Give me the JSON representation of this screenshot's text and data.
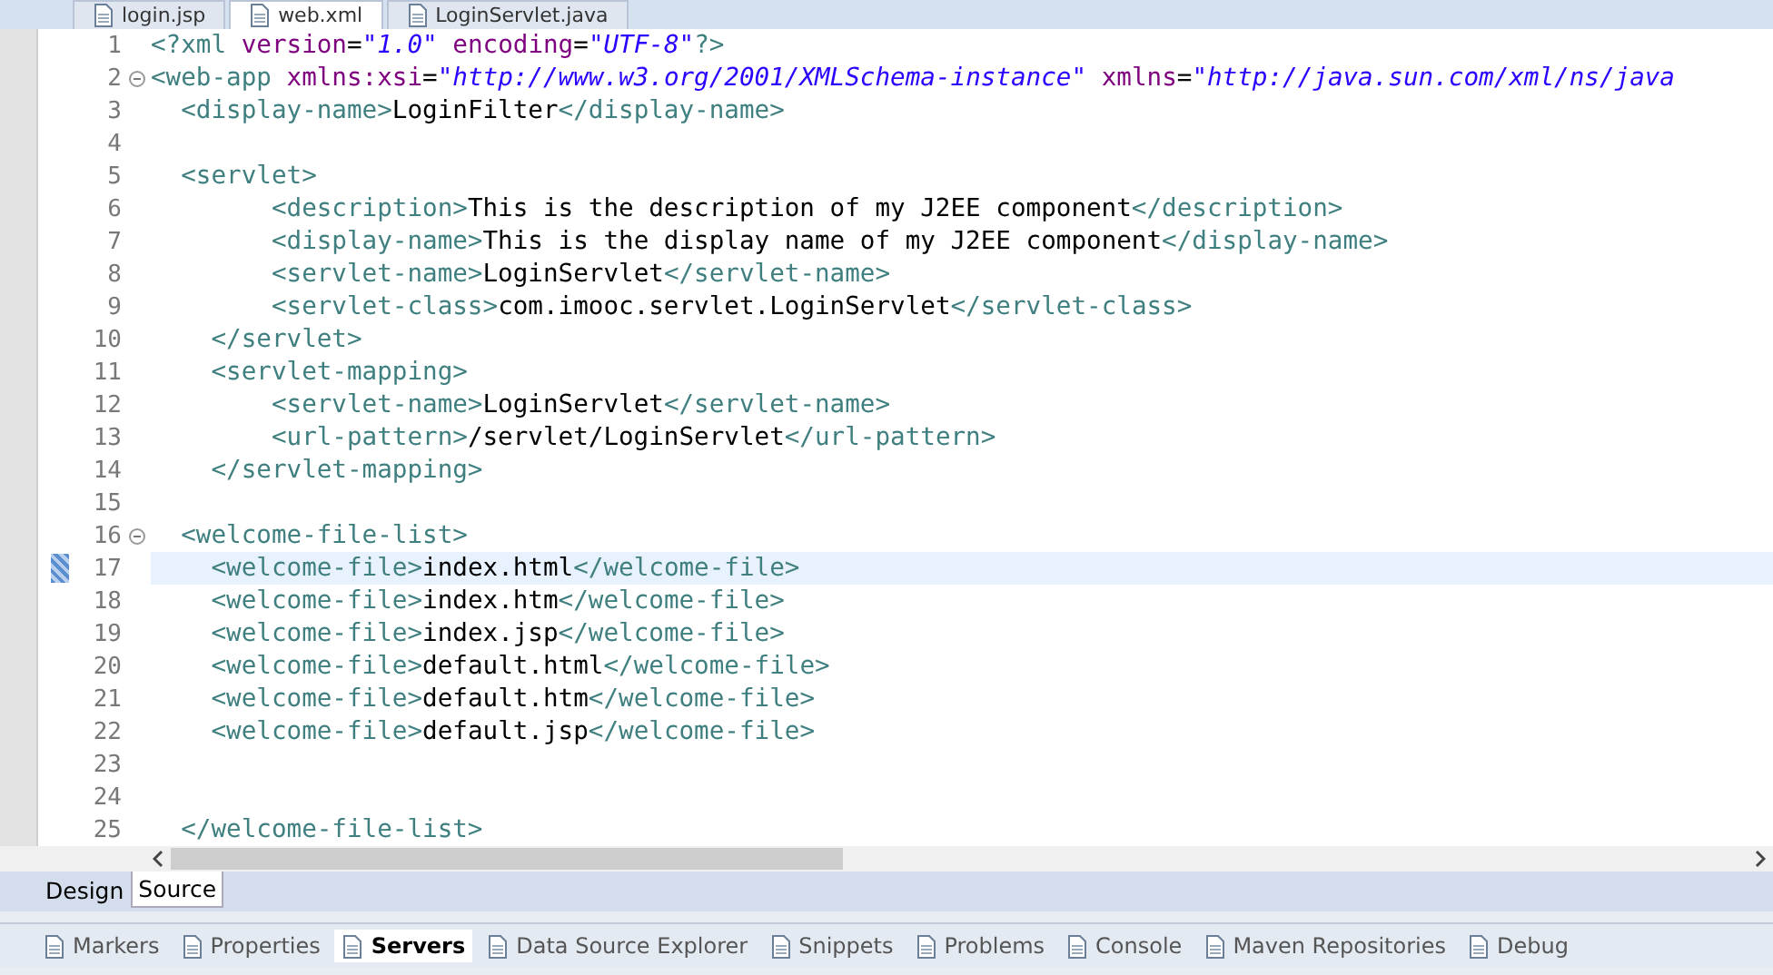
{
  "editor_tabs": [
    {
      "label": "login.jsp",
      "selected": false
    },
    {
      "label": "web.xml",
      "selected": true
    },
    {
      "label": "LoginServlet.java",
      "selected": false
    }
  ],
  "code_lines": [
    {
      "number": "1",
      "fold": false,
      "selected": false,
      "tokens": [
        {
          "kind": "tag",
          "text": "<?xml "
        },
        {
          "kind": "attr",
          "text": "version"
        },
        {
          "kind": "text",
          "text": "="
        },
        {
          "kind": "string",
          "text": "\"1.0\""
        },
        {
          "kind": "attr",
          "text": " encoding"
        },
        {
          "kind": "text",
          "text": "="
        },
        {
          "kind": "string",
          "text": "\"UTF-8\""
        },
        {
          "kind": "tag",
          "text": "?>"
        }
      ]
    },
    {
      "number": "2",
      "fold": true,
      "selected": false,
      "tokens": [
        {
          "kind": "tag",
          "text": "<web-app "
        },
        {
          "kind": "attr",
          "text": "xmlns:xsi"
        },
        {
          "kind": "text",
          "text": "="
        },
        {
          "kind": "string",
          "text": "\"http://www.w3.org/2001/XMLSchema-instance\""
        },
        {
          "kind": "attr",
          "text": " xmlns"
        },
        {
          "kind": "text",
          "text": "="
        },
        {
          "kind": "string",
          "text": "\"http://java.sun.com/xml/ns/java"
        }
      ]
    },
    {
      "number": "3",
      "fold": false,
      "selected": false,
      "tokens": [
        {
          "kind": "tag",
          "text": "  <display-name>"
        },
        {
          "kind": "text",
          "text": "LoginFilter"
        },
        {
          "kind": "tag",
          "text": "</display-name>"
        }
      ]
    },
    {
      "number": "4",
      "fold": false,
      "selected": false
    },
    {
      "number": "5",
      "fold": false,
      "selected": false,
      "tokens": [
        {
          "kind": "tag",
          "text": "  <servlet>"
        }
      ]
    },
    {
      "number": "6",
      "fold": false,
      "selected": false,
      "tokens": [
        {
          "kind": "tag",
          "text": "        <description>"
        },
        {
          "kind": "text",
          "text": "This is the description of my J2EE component"
        },
        {
          "kind": "tag",
          "text": "</description>"
        }
      ]
    },
    {
      "number": "7",
      "fold": false,
      "selected": false,
      "tokens": [
        {
          "kind": "tag",
          "text": "        <display-name>"
        },
        {
          "kind": "text",
          "text": "This is the display name of my J2EE component"
        },
        {
          "kind": "tag",
          "text": "</display-name>"
        }
      ]
    },
    {
      "number": "8",
      "fold": false,
      "selected": false,
      "tokens": [
        {
          "kind": "tag",
          "text": "        <servlet-name>"
        },
        {
          "kind": "text",
          "text": "LoginServlet"
        },
        {
          "kind": "tag",
          "text": "</servlet-name>"
        }
      ]
    },
    {
      "number": "9",
      "fold": false,
      "selected": false,
      "tokens": [
        {
          "kind": "tag",
          "text": "        <servlet-class>"
        },
        {
          "kind": "text",
          "text": "com.imooc.servlet.LoginServlet"
        },
        {
          "kind": "tag",
          "text": "</servlet-class>"
        }
      ]
    },
    {
      "number": "10",
      "fold": false,
      "selected": false,
      "tokens": [
        {
          "kind": "tag",
          "text": "    </servlet>"
        }
      ]
    },
    {
      "number": "11",
      "fold": false,
      "selected": false,
      "tokens": [
        {
          "kind": "tag",
          "text": "    <servlet-mapping>"
        }
      ]
    },
    {
      "number": "12",
      "fold": false,
      "selected": false,
      "tokens": [
        {
          "kind": "tag",
          "text": "        <servlet-name>"
        },
        {
          "kind": "text",
          "text": "LoginServlet"
        },
        {
          "kind": "tag",
          "text": "</servlet-name>"
        }
      ]
    },
    {
      "number": "13",
      "fold": false,
      "selected": false,
      "tokens": [
        {
          "kind": "tag",
          "text": "        <url-pattern>"
        },
        {
          "kind": "text",
          "text": "/servlet/LoginServlet"
        },
        {
          "kind": "tag",
          "text": "</url-pattern>"
        }
      ]
    },
    {
      "number": "14",
      "fold": false,
      "selected": false,
      "tokens": [
        {
          "kind": "tag",
          "text": "    </servlet-mapping>"
        }
      ]
    },
    {
      "number": "15",
      "fold": false,
      "selected": false
    },
    {
      "number": "16",
      "fold": true,
      "selected": false,
      "tokens": [
        {
          "kind": "tag",
          "text": "  <welcome-file-list>"
        }
      ]
    },
    {
      "number": "17",
      "fold": false,
      "selected": true,
      "tokens": [
        {
          "kind": "tag",
          "text": "    <welcome-file>"
        },
        {
          "kind": "text",
          "text": "index.html"
        },
        {
          "kind": "tag",
          "text": "</welcome-file>"
        }
      ]
    },
    {
      "number": "18",
      "fold": false,
      "selected": false,
      "tokens": [
        {
          "kind": "tag",
          "text": "    <welcome-file>"
        },
        {
          "kind": "text",
          "text": "index.htm"
        },
        {
          "kind": "tag",
          "text": "</welcome-file>"
        }
      ]
    },
    {
      "number": "19",
      "fold": false,
      "selected": false,
      "tokens": [
        {
          "kind": "tag",
          "text": "    <welcome-file>"
        },
        {
          "kind": "text",
          "text": "index.jsp"
        },
        {
          "kind": "tag",
          "text": "</welcome-file>"
        }
      ]
    },
    {
      "number": "20",
      "fold": false,
      "selected": false,
      "tokens": [
        {
          "kind": "tag",
          "text": "    <welcome-file>"
        },
        {
          "kind": "text",
          "text": "default.html"
        },
        {
          "kind": "tag",
          "text": "</welcome-file>"
        }
      ]
    },
    {
      "number": "21",
      "fold": false,
      "selected": false,
      "tokens": [
        {
          "kind": "tag",
          "text": "    <welcome-file>"
        },
        {
          "kind": "text",
          "text": "default.htm"
        },
        {
          "kind": "tag",
          "text": "</welcome-file>"
        }
      ]
    },
    {
      "number": "22",
      "fold": false,
      "selected": false,
      "tokens": [
        {
          "kind": "tag",
          "text": "    <welcome-file>"
        },
        {
          "kind": "text",
          "text": "default.jsp"
        },
        {
          "kind": "tag",
          "text": "</welcome-file>"
        }
      ]
    },
    {
      "number": "23",
      "fold": false,
      "selected": false
    },
    {
      "number": "24",
      "fold": false,
      "selected": false
    },
    {
      "number": "25",
      "fold": false,
      "selected": false,
      "tokens": [
        {
          "kind": "tag",
          "text": "  </welcome-file-list>"
        }
      ]
    }
  ],
  "view_tabs": [
    {
      "label": "Design",
      "selected": false
    },
    {
      "label": "Source",
      "selected": true
    }
  ],
  "panel_tabs": [
    {
      "label": "Markers",
      "selected": false
    },
    {
      "label": "Properties",
      "selected": false
    },
    {
      "label": "Servers",
      "selected": true
    },
    {
      "label": "Data Source Explorer",
      "selected": false
    },
    {
      "label": "Snippets",
      "selected": false
    },
    {
      "label": "Problems",
      "selected": false
    },
    {
      "label": "Console",
      "selected": false
    },
    {
      "label": "Maven Repositories",
      "selected": false
    },
    {
      "label": "Debug",
      "selected": false
    }
  ]
}
